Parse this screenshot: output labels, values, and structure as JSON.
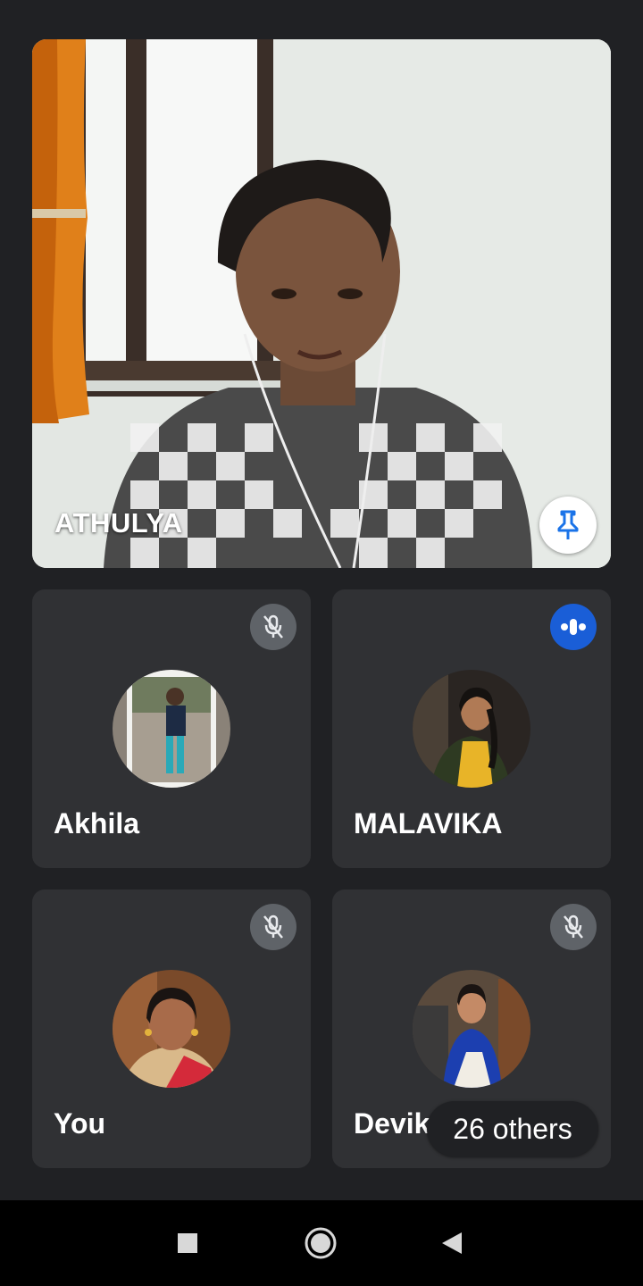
{
  "main_video": {
    "participant_name": "ATHULYA",
    "pin_icon": "pin-icon"
  },
  "tiles": [
    {
      "name": "Akhila",
      "status_icon": "mic-off-icon"
    },
    {
      "name": "MALAVIKA",
      "status_icon": "speaking-icon"
    },
    {
      "name": "You",
      "status_icon": "mic-off-icon"
    },
    {
      "name": "Devika",
      "status_icon": "mic-off-icon"
    }
  ],
  "others_chip": {
    "label": "26 others"
  },
  "nav": {
    "recents_icon": "square-icon",
    "home_icon": "circle-icon",
    "back_icon": "triangle-back-icon"
  },
  "colors": {
    "background": "#202124",
    "tile": "#303134",
    "speaking_accent": "#1a5ed7",
    "pin_accent": "#1a73e8",
    "muted_badge": "#5f6368"
  }
}
